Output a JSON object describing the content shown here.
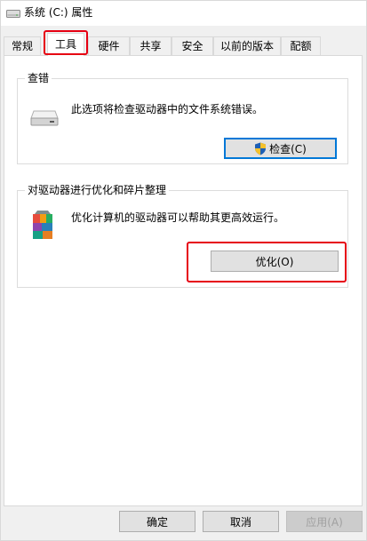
{
  "window": {
    "title": "系统 (C:) 属性"
  },
  "tabs": [
    {
      "label": "常规",
      "active": false
    },
    {
      "label": "工具",
      "active": true
    },
    {
      "label": "硬件",
      "active": false
    },
    {
      "label": "共享",
      "active": false
    },
    {
      "label": "安全",
      "active": false
    },
    {
      "label": "以前的版本",
      "active": false
    },
    {
      "label": "配额",
      "active": false
    }
  ],
  "error_check": {
    "group_label": "查错",
    "description": "此选项将检查驱动器中的文件系统错误。",
    "button_label": "检查(C)",
    "icon": "drive-icon"
  },
  "optimize": {
    "group_label": "对驱动器进行优化和碎片整理",
    "description": "优化计算机的驱动器可以帮助其更高效运行。",
    "button_label": "优化(O)",
    "icon": "defrag-icon"
  },
  "footer": {
    "ok_label": "确定",
    "cancel_label": "取消",
    "apply_label": "应用(A)"
  },
  "colors": {
    "highlight": "#e60012",
    "accent": "#0078d7"
  }
}
